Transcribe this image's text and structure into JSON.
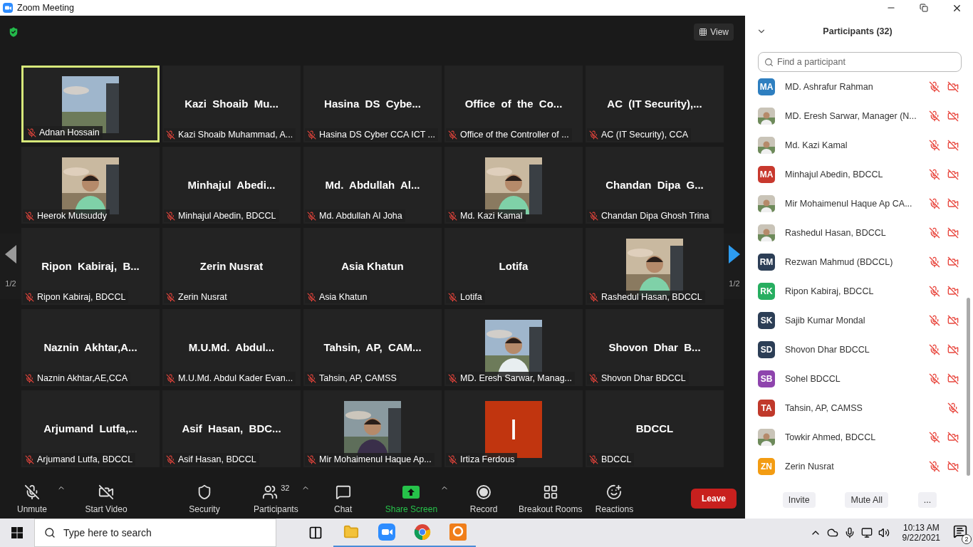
{
  "window": {
    "title": "Zoom Meeting"
  },
  "meeting": {
    "view_button": "View",
    "page_left": "1/2",
    "page_right": "1/2",
    "tiles": [
      {
        "kind": "picture",
        "label": "Adnan Hossain",
        "speaking": true
      },
      {
        "kind": "name",
        "name": "Kazi  Shoaib  Mu...",
        "label": "Kazi Shoaib Muhammad, A...",
        "speaking": false
      },
      {
        "kind": "name",
        "name": "Hasina  DS  Cybe...",
        "label": "Hasina DS Cyber CCA ICT ...",
        "speaking": false
      },
      {
        "kind": "name",
        "name": "Office  of  the  Co...",
        "label": "Office of the Controller of ...",
        "speaking": false
      },
      {
        "kind": "name",
        "name": "AC  (IT Security),...",
        "label": "AC (IT Security), CCA",
        "speaking": false
      },
      {
        "kind": "picture",
        "label": "Heerok Mutsuddy",
        "speaking": false
      },
      {
        "kind": "name",
        "name": "Minhajul  Abedi...",
        "label": "Minhajul Abedin, BDCCL",
        "speaking": false
      },
      {
        "kind": "name",
        "name": "Md.  Abdullah  Al...",
        "label": "Md. Abdullah Al Joha",
        "speaking": false
      },
      {
        "kind": "picture",
        "label": "Md. Kazi Kamal",
        "speaking": false
      },
      {
        "kind": "name",
        "name": "Chandan  Dipa  G...",
        "label": "Chandan Dipa Ghosh Trina",
        "speaking": false
      },
      {
        "kind": "name",
        "name": "Ripon  Kabiraj,  B...",
        "label": "Ripon Kabiraj, BDCCL",
        "speaking": false
      },
      {
        "kind": "name",
        "name": "Zerin Nusrat",
        "label": "Zerin Nusrat",
        "speaking": false
      },
      {
        "kind": "name",
        "name": "Asia Khatun",
        "label": "Asia Khatun",
        "speaking": false
      },
      {
        "kind": "name",
        "name": "Lotifa",
        "label": "Lotifa",
        "speaking": false
      },
      {
        "kind": "picture",
        "label": "Rashedul Hasan, BDCCL",
        "speaking": false
      },
      {
        "kind": "name",
        "name": "Naznin  Akhtar,A...",
        "label": "Naznin Akhtar,AE,CCA",
        "speaking": false
      },
      {
        "kind": "name",
        "name": "M.U.Md.  Abdul...",
        "label": "M.U.Md. Abdul Kader Evan...",
        "speaking": false
      },
      {
        "kind": "name",
        "name": "Tahsin,  AP,  CAM...",
        "label": "Tahsin, AP, CAMSS",
        "speaking": false
      },
      {
        "kind": "picture",
        "label": "MD. Eresh Sarwar, Manag...",
        "speaking": false
      },
      {
        "kind": "name",
        "name": "Shovon  Dhar  B...",
        "label": "Shovon Dhar BDCCL",
        "speaking": false
      },
      {
        "kind": "name",
        "name": "Arjumand  Lutfa,...",
        "label": "Arjumand Lutfa, BDCCL",
        "speaking": false
      },
      {
        "kind": "name",
        "name": "Asif  Hasan,  BDC...",
        "label": "Asif Hasan, BDCCL",
        "speaking": false
      },
      {
        "kind": "picture",
        "label": "Mir Mohaimenul Haque Ap...",
        "speaking": false
      },
      {
        "kind": "initial",
        "initial": "I",
        "color": "#c1350f",
        "label": "Irtiza Ferdous",
        "speaking": false
      },
      {
        "kind": "name",
        "name": "BDCCL",
        "label": "BDCCL",
        "speaking": false
      }
    ]
  },
  "toolbar": {
    "items": [
      {
        "kind": "mic",
        "label": "Unmute",
        "caret": true
      },
      {
        "kind": "video",
        "label": "Start Video",
        "caret": false
      },
      {
        "kind": "security",
        "label": "Security",
        "caret": false
      },
      {
        "kind": "participants",
        "label": "Participants",
        "count": "32",
        "caret": true
      },
      {
        "kind": "chat",
        "label": "Chat",
        "caret": false
      },
      {
        "kind": "share",
        "label": "Share Screen",
        "caret": true
      },
      {
        "kind": "record",
        "label": "Record",
        "caret": false
      },
      {
        "kind": "breakout",
        "label": "Breakout Rooms",
        "caret": false
      },
      {
        "kind": "reactions",
        "label": "Reactions",
        "caret": false
      }
    ],
    "leave": "Leave"
  },
  "participants_panel": {
    "title": "Participants (32)",
    "search": {
      "placeholder": "Find a participant"
    },
    "list": [
      {
        "name": "MD. Ashrafur Rahman",
        "kind": "initials",
        "initials": "MA",
        "color": "#2e7fc0",
        "video_icon": true
      },
      {
        "name": "MD. Eresh Sarwar, Manager (N...",
        "kind": "picture",
        "video_icon": true
      },
      {
        "name": "Md. Kazi Kamal",
        "kind": "picture",
        "video_icon": true
      },
      {
        "name": "Minhajul Abedin, BDCCL",
        "kind": "initials",
        "initials": "MA",
        "color": "#c8392e",
        "video_icon": true
      },
      {
        "name": "Mir Mohaimenul Haque Ap CA...",
        "kind": "picture",
        "video_icon": true
      },
      {
        "name": "Rashedul Hasan, BDCCL",
        "kind": "picture",
        "video_icon": true
      },
      {
        "name": "Rezwan Mahmud (BDCCL)",
        "kind": "initials",
        "initials": "RM",
        "color": "#2c3e56",
        "video_icon": true
      },
      {
        "name": "Ripon Kabiraj, BDCCL",
        "kind": "initials",
        "initials": "RK",
        "color": "#27ae60",
        "video_icon": true
      },
      {
        "name": "Sajib Kumar Mondal",
        "kind": "initials",
        "initials": "SK",
        "color": "#2c3e56",
        "video_icon": true
      },
      {
        "name": "Shovon Dhar BDCCL",
        "kind": "initials",
        "initials": "SD",
        "color": "#2c3e56",
        "video_icon": true
      },
      {
        "name": "Sohel BDCCL",
        "kind": "initials",
        "initials": "SB",
        "color": "#8e44ad",
        "video_icon": true
      },
      {
        "name": "Tahsin, AP, CAMSS",
        "kind": "initials",
        "initials": "TA",
        "color": "#c0392b",
        "video_icon": false
      },
      {
        "name": "Towkir Ahmed, BDCCL",
        "kind": "picture",
        "video_icon": true
      },
      {
        "name": "Zerin Nusrat",
        "kind": "initials",
        "initials": "ZN",
        "color": "#f39c12",
        "video_icon": true
      }
    ],
    "buttons": [
      "Invite",
      "Mute All",
      "..."
    ]
  },
  "taskbar": {
    "search": {
      "placeholder": "Type here to search"
    },
    "apps": [
      {
        "kind": "taskview"
      },
      {
        "kind": "explorer"
      },
      {
        "kind": "zoom"
      },
      {
        "kind": "chrome"
      },
      {
        "kind": "pdf"
      }
    ],
    "time": "10:13 AM",
    "date": "9/22/2021",
    "notifications": "2"
  }
}
